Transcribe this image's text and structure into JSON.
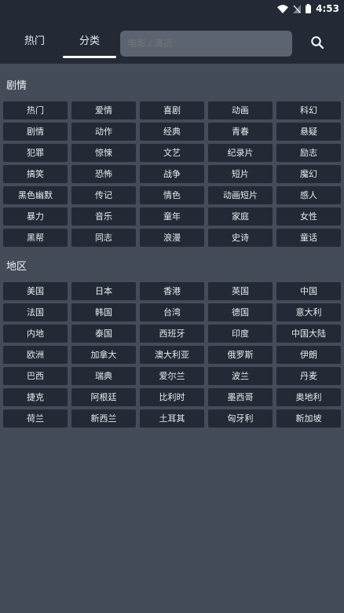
{
  "status": {
    "time": "4:53"
  },
  "header": {
    "tabs": [
      {
        "label": "热门"
      },
      {
        "label": "分类"
      }
    ],
    "active_tab": "分类",
    "search_placeholder": "电影 / 演员"
  },
  "genre": {
    "title": "剧情",
    "items": [
      "热门",
      "爱情",
      "喜剧",
      "动画",
      "科幻",
      "剧情",
      "动作",
      "经典",
      "青春",
      "悬疑",
      "犯罪",
      "惊悚",
      "文艺",
      "纪录片",
      "励志",
      "搞笑",
      "恐怖",
      "战争",
      "短片",
      "魔幻",
      "黑色幽默",
      "传记",
      "情色",
      "动画短片",
      "感人",
      "暴力",
      "音乐",
      "童年",
      "家庭",
      "女性",
      "黑帮",
      "同志",
      "浪漫",
      "史诗",
      "童话"
    ]
  },
  "region": {
    "title": "地区",
    "items": [
      "美国",
      "日本",
      "香港",
      "英国",
      "中国",
      "法国",
      "韩国",
      "台湾",
      "德国",
      "意大利",
      "内地",
      "泰国",
      "西班牙",
      "印度",
      "中国大陆",
      "欧洲",
      "加拿大",
      "澳大利亚",
      "俄罗斯",
      "伊朗",
      "巴西",
      "瑞典",
      "爱尔兰",
      "波兰",
      "丹麦",
      "捷克",
      "阿根廷",
      "比利时",
      "墨西哥",
      "奥地利",
      "荷兰",
      "新西兰",
      "土耳其",
      "匈牙利",
      "新加坡"
    ]
  },
  "colors": {
    "background": "#434c58",
    "header": "#232a36",
    "chip": "#232a36",
    "search_field": "#5b6470"
  }
}
